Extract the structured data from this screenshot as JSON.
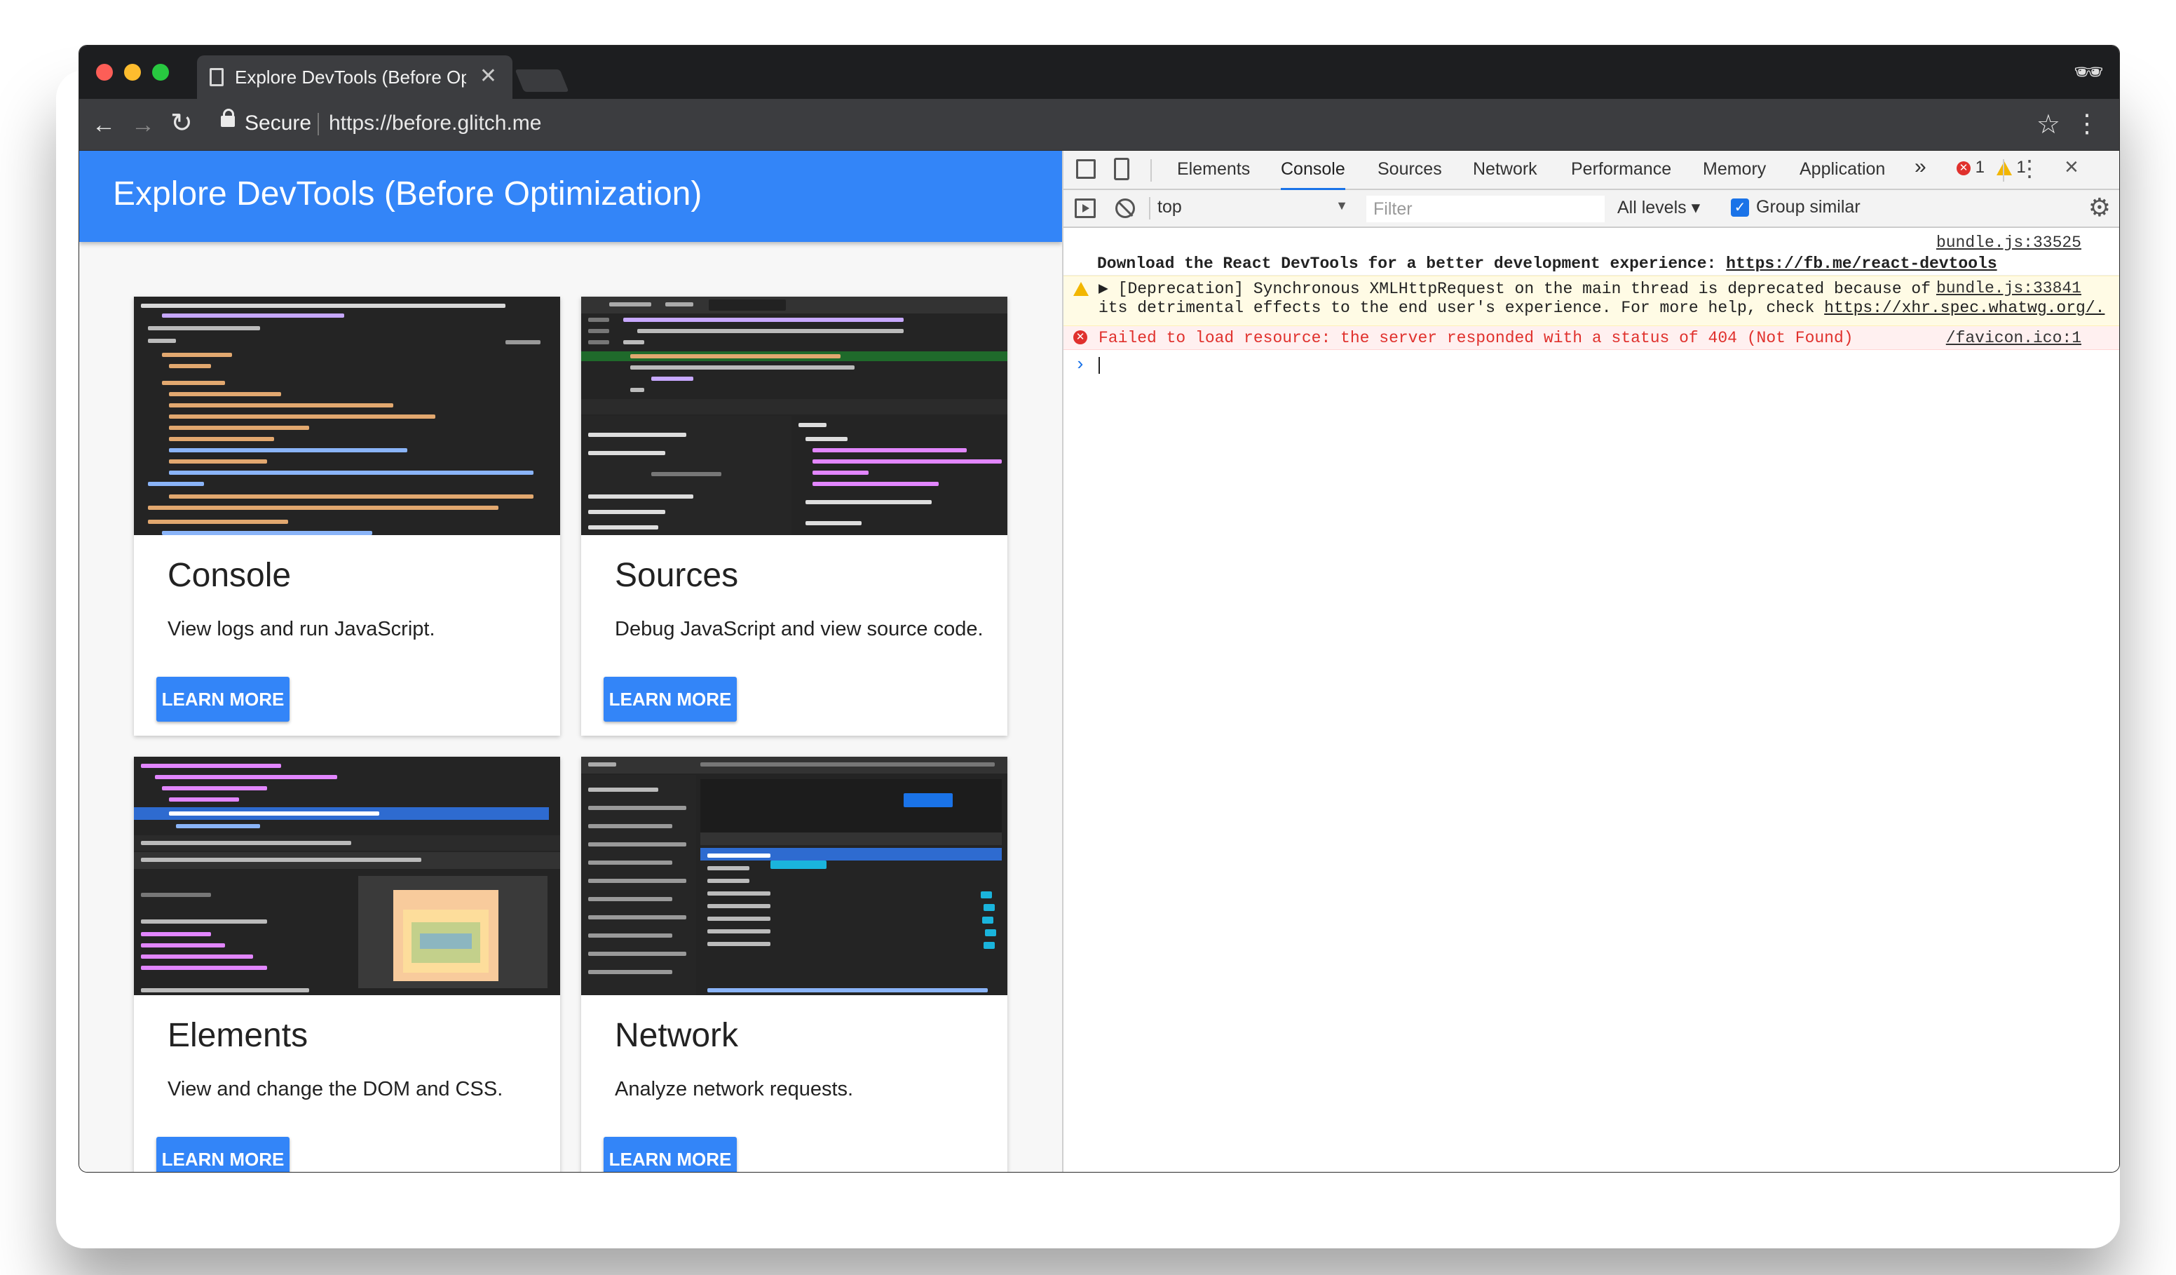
{
  "browser": {
    "tab_title": "Explore DevTools (Before Optimization)",
    "tab_close": "✕",
    "secure_label": "Secure",
    "url": "https://before.glitch.me"
  },
  "page": {
    "title": "Explore DevTools (Before Optimization)",
    "button_label": "LEARN MORE",
    "cards": [
      {
        "title": "Console",
        "desc": "View logs and run JavaScript."
      },
      {
        "title": "Sources",
        "desc": "Debug JavaScript and view source code."
      },
      {
        "title": "Elements",
        "desc": "View and change the DOM and CSS."
      },
      {
        "title": "Network",
        "desc": "Analyze network requests."
      }
    ]
  },
  "devtools": {
    "tabs": [
      "Elements",
      "Console",
      "Sources",
      "Network",
      "Performance",
      "Memory",
      "Application"
    ],
    "more": "»",
    "error_count": "1",
    "warning_count": "1",
    "context": "top",
    "filter_placeholder": "Filter",
    "levels": "All levels ▾",
    "group_similar": "Group similar",
    "messages": [
      {
        "src": "bundle.js:33525",
        "text": "Download the React DevTools for a better development experience: ",
        "link": "https://fb.me/react-devtools"
      },
      {
        "src": "bundle.js:33841",
        "line1": "▶ [Deprecation] Synchronous XMLHttpRequest on the main thread is deprecated because of",
        "line2": "its detrimental effects to the end user's experience. For more help, check ",
        "link": "https://xhr.spec.whatwg.org/."
      },
      {
        "src": "/favicon.ico:1",
        "text": "Failed to load resource: the server responded with a status of 404 (Not Found)"
      }
    ],
    "prompt": "›"
  },
  "colors": {
    "accent": "#3385f8",
    "error": "#e0312d",
    "warning": "#f2b600"
  }
}
